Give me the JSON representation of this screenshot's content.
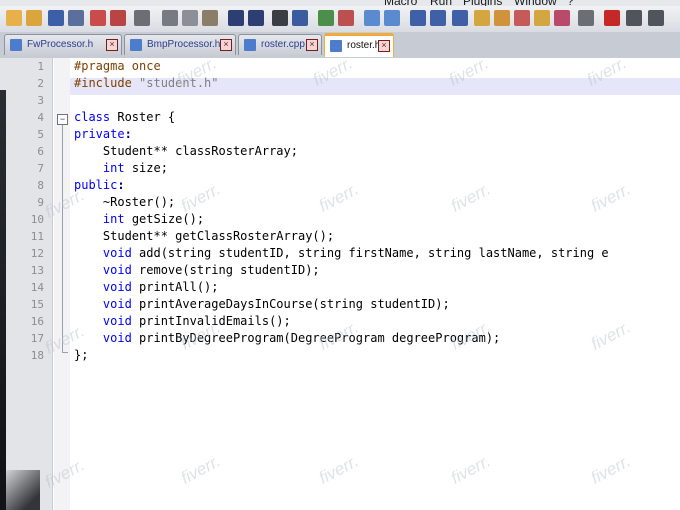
{
  "menu": {
    "items": [
      "Macro",
      "Run",
      "Plugins",
      "Window",
      "?"
    ]
  },
  "tabs": [
    {
      "label": "FwProcessor.h",
      "active": false
    },
    {
      "label": "BmpProcessor.h",
      "active": false
    },
    {
      "label": "roster.cpp",
      "active": false
    },
    {
      "label": "roster.h",
      "active": true
    }
  ],
  "editor": {
    "line_numbers": [
      "1",
      "2",
      "3",
      "4",
      "5",
      "6",
      "7",
      "8",
      "9",
      "10",
      "11",
      "12",
      "13",
      "14",
      "15",
      "16",
      "17",
      "18"
    ],
    "lines": [
      {
        "pre": "#pragma once"
      },
      {
        "pre": "#include ",
        "str": "\"student.h\""
      },
      {},
      {
        "kw": "class",
        "text": " Roster {"
      },
      {
        "kw": "private",
        "op": ":"
      },
      {
        "indent": "    ",
        "text": "Student** classRosterArray;"
      },
      {
        "indent": "    ",
        "kw": "int",
        "text": " size;"
      },
      {
        "kw": "public",
        "op": ":"
      },
      {
        "indent": "    ",
        "text": "~Roster();"
      },
      {
        "indent": "    ",
        "kw": "int",
        "text": " getSize();"
      },
      {
        "indent": "    ",
        "text": "Student** getClassRosterArray();"
      },
      {
        "indent": "    ",
        "kw": "void",
        "text": " add(string studentID, string firstName, string lastName, string e"
      },
      {
        "indent": "    ",
        "kw": "void",
        "text": " remove(string studentID);"
      },
      {
        "indent": "    ",
        "kw": "void",
        "text": " printAll();"
      },
      {
        "indent": "    ",
        "kw": "void",
        "text": " printAverageDaysInCourse(string studentID);"
      },
      {
        "indent": "    ",
        "kw": "void",
        "text": " printInvalidEmails();"
      },
      {
        "indent": "    ",
        "kw": "void",
        "text": " printByDegreeProgram(DegreeProgram degreeProgram);"
      },
      {
        "text": "};"
      }
    ]
  },
  "watermark": "fiverr.",
  "colors": {
    "keyword": "#0000ff",
    "preprocessor": "#804000",
    "string": "#808080",
    "current_line": "#e6e6fa",
    "active_tab_accent": "#f2a93b"
  }
}
